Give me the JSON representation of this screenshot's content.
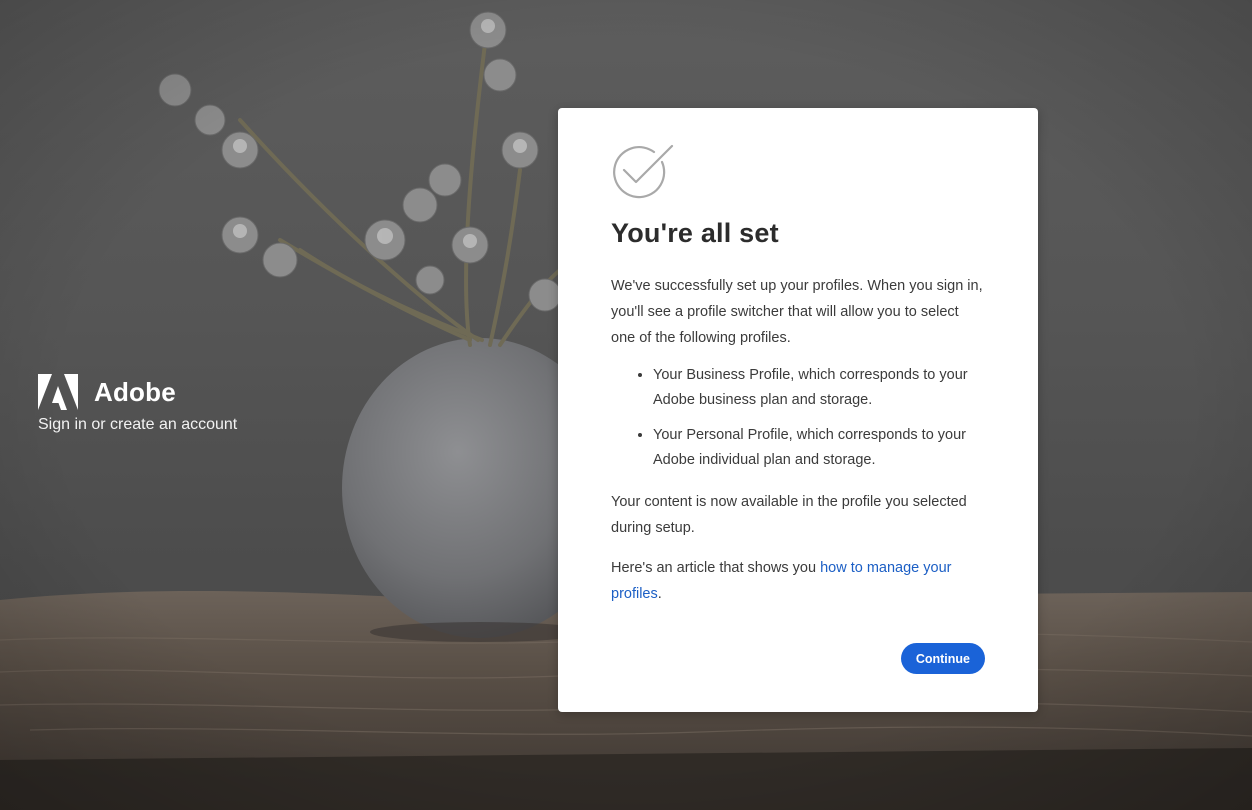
{
  "brand": {
    "logo_icon": "adobe-logo-icon",
    "name": "Adobe",
    "subtitle": "Sign in or create an account"
  },
  "card": {
    "icon": "checkmark-circle-icon",
    "title": "You're all set",
    "intro": "We've successfully set up your profiles. When you sign in, you'll see a profile switcher that will allow you to select one of the following profiles.",
    "bullets": [
      "Your Business Profile, which corresponds to your Adobe business plan and storage.",
      "Your Personal Profile, which corresponds to your Adobe individual plan and storage."
    ],
    "content_note": "Your content is now available in the profile you selected during setup.",
    "article_prefix": "Here's an article that shows you ",
    "article_link": "how to manage your profiles",
    "article_suffix": ".",
    "continue_label": "Continue"
  },
  "colors": {
    "accent": "#1a63d8",
    "link": "#1c5fc5",
    "background": "#555555"
  }
}
